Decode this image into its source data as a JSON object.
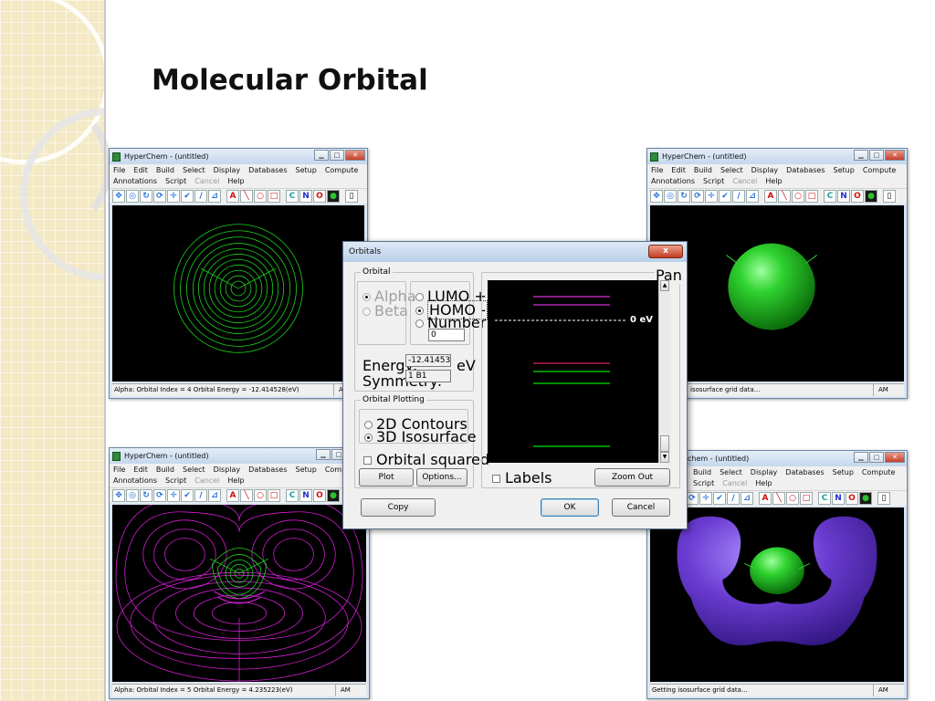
{
  "slide": {
    "title": "Molecular Orbital"
  },
  "app_window": {
    "title": "HyperChem - (untitled)",
    "menu": [
      "File",
      "Edit",
      "Build",
      "Select",
      "Display",
      "Databases",
      "Setup",
      "Compute",
      "Annotations",
      "Script",
      "Cancel",
      "Help"
    ],
    "toolbar_letters": [
      "A",
      "C",
      "N",
      "O"
    ],
    "status_am": "AM"
  },
  "windows": {
    "top_left": {
      "status": "Alpha: Orbital Index = 4 Orbital Energy = -12.414528(eV)"
    },
    "top_right": {
      "status": "isosurface grid data..."
    },
    "bottom_left": {
      "status": "Alpha: Orbital Index = 5 Orbital Energy = 4.235223(eV)"
    },
    "bottom_right": {
      "title": "chem - (untitled)",
      "status": "Getting isosurface grid data..."
    }
  },
  "dialog": {
    "title": "Orbitals",
    "close": "x",
    "orbital_group": "Orbital",
    "alpha": "Alpha",
    "beta": "Beta",
    "lumo": "LUMO +",
    "homo": "HOMO -",
    "number": "Number",
    "offset_value": "0",
    "energy_label": "Energy:",
    "energy_value": "-12.41453",
    "energy_unit": "eV",
    "symmetry_label": "Symmetry:",
    "symmetry_value": "1 B1",
    "plotting_group": "Orbital Plotting",
    "contours_2d": "2D Contours",
    "isosurface_3d": "3D Isosurface",
    "orbital_squared": "Orbital squared",
    "plot_button": "Plot",
    "options_button": "Options...",
    "copy_button": "Copy",
    "pan_label": "Pan",
    "zero_ev": "0 eV",
    "labels": "Labels",
    "zoom_out": "Zoom Out",
    "ok": "OK",
    "cancel": "Cancel"
  },
  "energy_levels": {
    "colors": {
      "occupied": "#00e400",
      "homo_selected": "#e0205a",
      "virtual": "#d030d0",
      "zero_line": "#ffffff"
    }
  },
  "colors": {
    "contour_green": "#1ed21e",
    "contour_magenta": "#d21ed2",
    "sphere_green": "#18c018",
    "isosurface_purple": "#6a3bd0"
  }
}
